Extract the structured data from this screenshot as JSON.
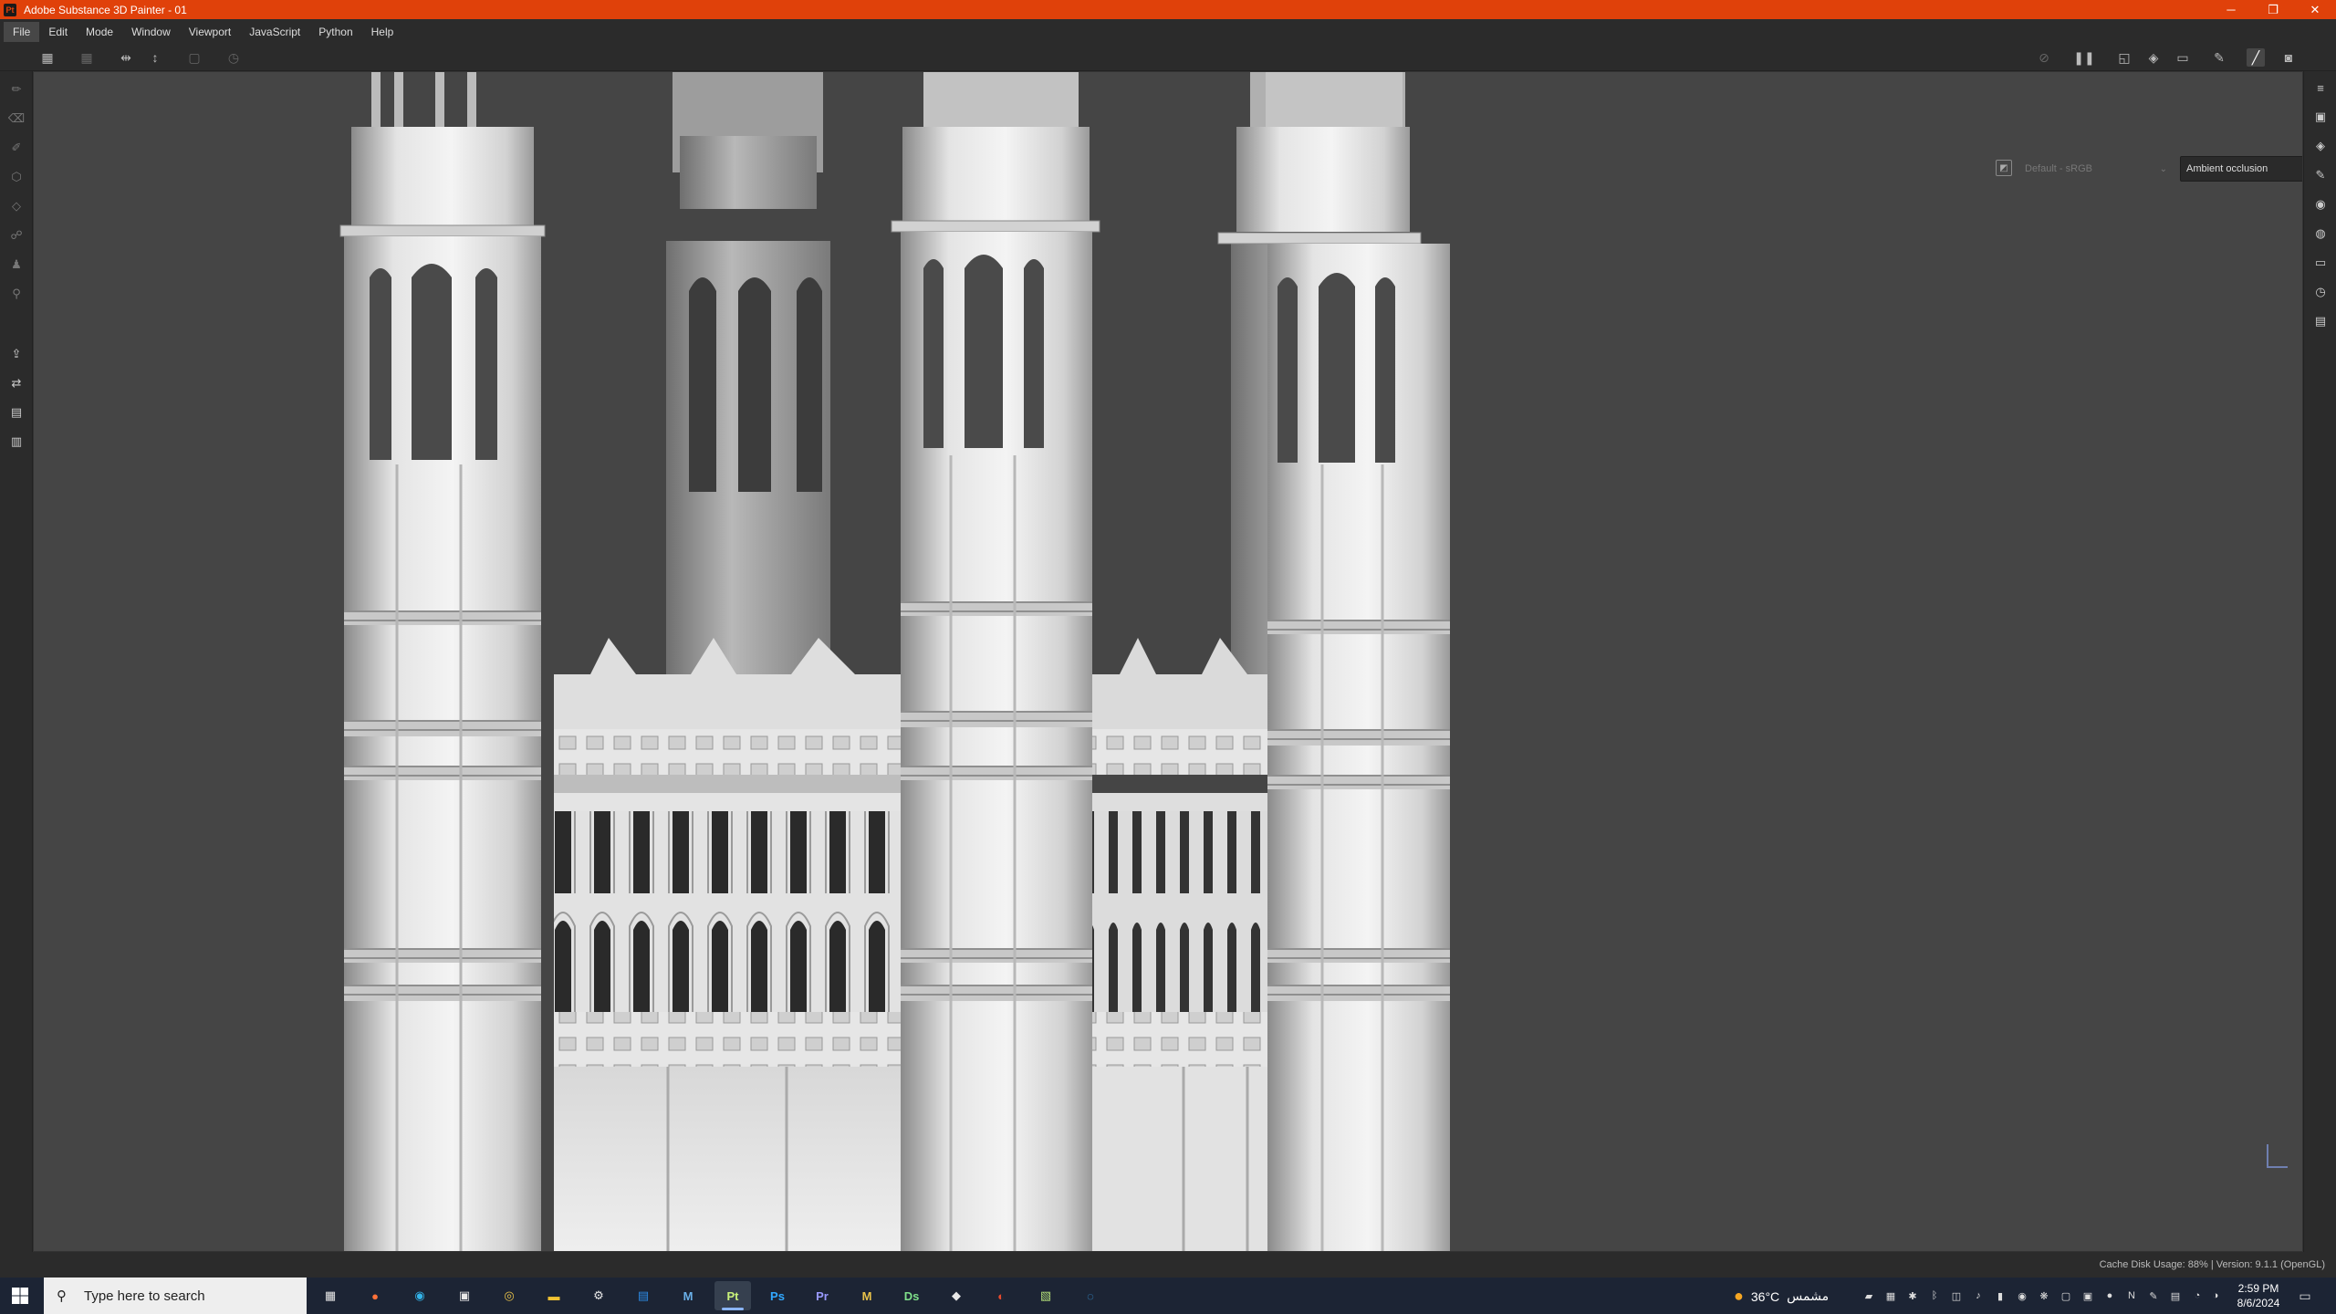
{
  "window": {
    "title": "Adobe Substance 3D Painter - 01",
    "app_icon_label": "Pt",
    "controls": {
      "minimize": "─",
      "restore": "❐",
      "close": "✕"
    }
  },
  "menu": [
    {
      "label": "File"
    },
    {
      "label": "Edit"
    },
    {
      "label": "Mode"
    },
    {
      "label": "Window"
    },
    {
      "label": "Viewport"
    },
    {
      "label": "JavaScript"
    },
    {
      "label": "Python"
    },
    {
      "label": "Help"
    }
  ],
  "viewport": {
    "color_space": "Default - sRGB",
    "display_channel": "Ambient occlusion"
  },
  "status": {
    "text": "Cache Disk Usage:   88% | Version: 9.1.1 (OpenGL)"
  },
  "taskbar": {
    "search_placeholder": "Type here to search",
    "apps": [
      {
        "label": "▦",
        "color": "#e8e8e8",
        "name": "task-view-icon"
      },
      {
        "label": "●",
        "color": "#ff7139",
        "name": "firefox-icon"
      },
      {
        "label": "◉",
        "color": "#33b3e8",
        "name": "edge-icon"
      },
      {
        "label": "▣",
        "color": "#e8e8e8",
        "name": "store-icon"
      },
      {
        "label": "◎",
        "color": "#e8c24a",
        "name": "chrome-icon"
      },
      {
        "label": "▬",
        "color": "#f1c232",
        "name": "file-explorer-icon"
      },
      {
        "label": "⚙",
        "color": "#e8e8e8",
        "name": "app-gear-icon"
      },
      {
        "label": "▤",
        "color": "#2d8ce8",
        "name": "app-blue-icon"
      },
      {
        "label": "M",
        "color": "#6ab0e8",
        "name": "app-m-icon"
      },
      {
        "label": "Pt",
        "color": "#c9f27a",
        "name": "substance-painter-icon",
        "active": true
      },
      {
        "label": "Ps",
        "color": "#31a8ff",
        "name": "photoshop-icon"
      },
      {
        "label": "Pr",
        "color": "#9999ff",
        "name": "premiere-icon"
      },
      {
        "label": "M",
        "color": "#e8c24a",
        "name": "marvelous-icon"
      },
      {
        "label": "Ds",
        "color": "#7fe08a",
        "name": "substance-designer-icon"
      },
      {
        "label": "◆",
        "color": "#e8e8e8",
        "name": "app-diamond-icon"
      },
      {
        "label": "◐",
        "color": "#e84a2d",
        "name": "app-red-icon"
      },
      {
        "label": "▧",
        "color": "#b4e07a",
        "name": "app-green-icon"
      },
      {
        "label": "◌",
        "color": "#3aa0e8",
        "name": "app-ring-icon"
      }
    ],
    "weather": {
      "temp": "36°C",
      "desc": "مشمس"
    },
    "clock": {
      "time": "2:59 PM",
      "date": "8/6/2024"
    }
  },
  "colors": {
    "titlebar": "#e0410a",
    "panel": "#2b2b2b",
    "viewport": "#454545"
  }
}
